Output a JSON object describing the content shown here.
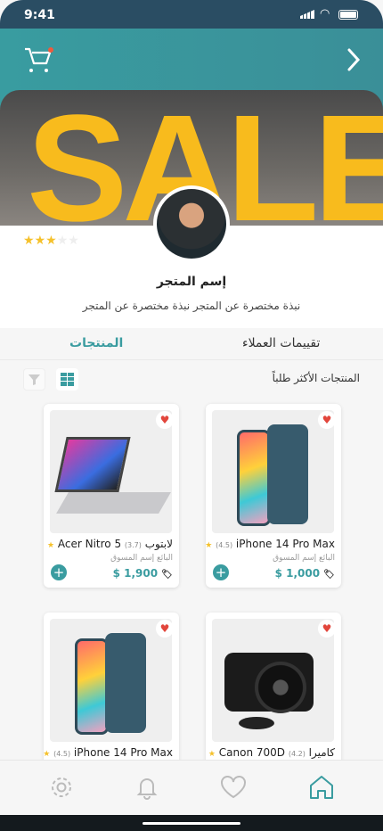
{
  "status": {
    "time": "9:41"
  },
  "header": {
    "cart_icon": "cart-icon",
    "back_icon": "chevron-right-icon"
  },
  "banner": {
    "text": "SALE"
  },
  "store": {
    "name": "إسم المتجر",
    "bio": "نبذة مختصرة عن المتجر نبذة مختصرة عن المتجر",
    "rating": 3,
    "max_rating": 5
  },
  "tabs": [
    {
      "label": "تقييمات العملاء",
      "active": false
    },
    {
      "label": "المنتجات",
      "active": true
    }
  ],
  "section": {
    "title": "المنتجات الأكثر طلباً"
  },
  "products": [
    {
      "title": "iPhone 14 Pro Max",
      "rating": "(4.5)",
      "seller": "البائع إسم المسوق",
      "price": "$ 1,000",
      "kind": "phone"
    },
    {
      "title": "لابتوب Acer Nitro 5",
      "rating": "(3.7)",
      "seller": "البائع إسم المسوق",
      "price": "$ 1,900",
      "kind": "laptop"
    },
    {
      "title": "كاميرا Canon 700D",
      "rating": "(4.2)",
      "kind": "camera"
    },
    {
      "title": "iPhone 14 Pro Max",
      "rating": "(4.5)",
      "kind": "phone"
    }
  ],
  "colors": {
    "accent": "#3a9ca0",
    "status_bar": "#2a4d63",
    "star": "#f5c12b",
    "heart": "#e2463c"
  }
}
